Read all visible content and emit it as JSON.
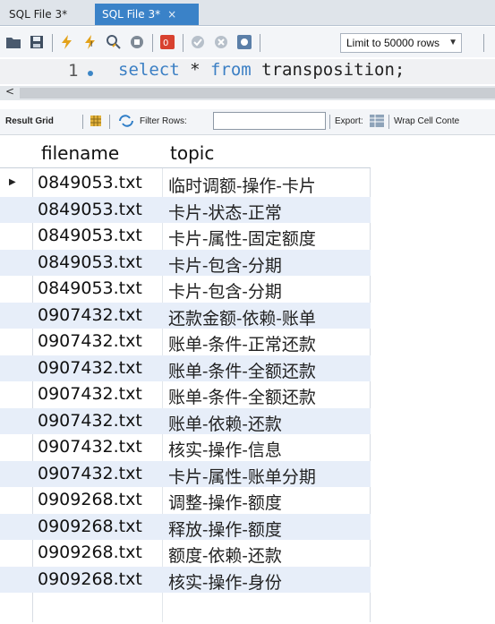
{
  "tabs": [
    {
      "label": "SQL File 3*"
    },
    {
      "label": "SQL File 3*",
      "close": "×"
    }
  ],
  "toolbar": {
    "icons": [
      "open-folder-icon",
      "save-icon",
      "execute-icon",
      "execute-current-icon",
      "explain-icon",
      "stop-icon",
      "toggle-output-icon",
      "commit-icon",
      "rollback-icon",
      "autocommit-icon"
    ],
    "limit_label": "Limit to 50000 rows"
  },
  "editor": {
    "line_number": "1",
    "code": {
      "kw1": "select",
      "star": " * ",
      "kw2": "from",
      "rest": " transposition;"
    }
  },
  "result_toolbar": {
    "result_grid": "Result Grid",
    "filter_rows": "Filter Rows:",
    "filter_value": "",
    "export": "Export:",
    "wrap": "Wrap Cell Conte"
  },
  "grid": {
    "columns": [
      "filename",
      "topic"
    ],
    "rows": [
      [
        "0849053.txt",
        "临时调额-操作-卡片"
      ],
      [
        "0849053.txt",
        "卡片-状态-正常"
      ],
      [
        "0849053.txt",
        "卡片-属性-固定额度"
      ],
      [
        "0849053.txt",
        "卡片-包含-分期"
      ],
      [
        "0849053.txt",
        "卡片-包含-分期"
      ],
      [
        "0907432.txt",
        "还款金额-依赖-账单"
      ],
      [
        "0907432.txt",
        "账单-条件-正常还款"
      ],
      [
        "0907432.txt",
        "账单-条件-全额还款"
      ],
      [
        "0907432.txt",
        "账单-条件-全额还款"
      ],
      [
        "0907432.txt",
        "账单-依赖-还款"
      ],
      [
        "0907432.txt",
        "核实-操作-信息"
      ],
      [
        "0907432.txt",
        "卡片-属性-账单分期"
      ],
      [
        "0909268.txt",
        "调整-操作-额度"
      ],
      [
        "0909268.txt",
        "释放-操作-额度"
      ],
      [
        "0909268.txt",
        "额度-依赖-还款"
      ],
      [
        "0909268.txt",
        "核实-操作-身份"
      ]
    ]
  },
  "colors": {
    "active_tab": "#3a82c8",
    "keyword": "#3b7fc4",
    "alt_row": "#e7eef9"
  }
}
